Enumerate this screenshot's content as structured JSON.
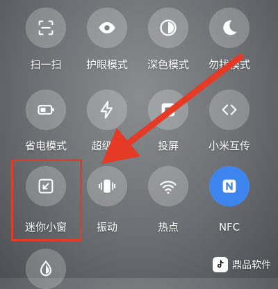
{
  "tiles": [
    {
      "label": "扫一扫",
      "icon": "scan-icon"
    },
    {
      "label": "护眼模式",
      "icon": "eye-icon"
    },
    {
      "label": "深色模式",
      "icon": "dark-mode-icon"
    },
    {
      "label": "勿扰模式",
      "icon": "moon-icon"
    },
    {
      "label": "省电模式",
      "icon": "battery-icon"
    },
    {
      "label": "超级省",
      "icon": "lightning-icon"
    },
    {
      "label": "投屏",
      "icon": "cast-icon"
    },
    {
      "label": "小米互传",
      "icon": "share-transfer-icon"
    },
    {
      "label": "迷你小窗",
      "icon": "mini-window-icon"
    },
    {
      "label": "振动",
      "icon": "vibrate-icon"
    },
    {
      "label": "热点",
      "icon": "hotspot-icon"
    },
    {
      "label": "NFC",
      "icon": "nfc-icon",
      "active": true
    },
    {
      "label": "",
      "icon": "contrast-icon"
    }
  ],
  "watermark": {
    "text": "鼎品软件",
    "icon": "tiktok-logo-icon"
  },
  "colors": {
    "highlight": "#e43a26",
    "active_tile": "#3d84ee",
    "arrow": "#e43a26"
  }
}
